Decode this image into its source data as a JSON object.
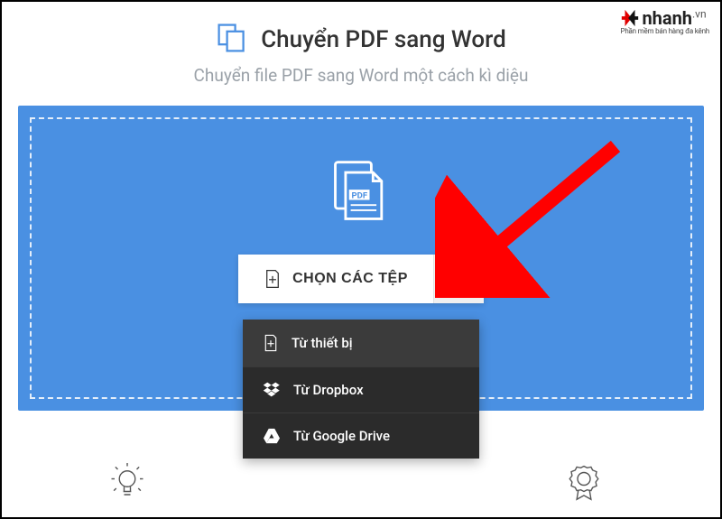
{
  "brand": {
    "name": "nhanh",
    "tld": ".vn",
    "tagline": "Phần mềm bán hàng đa kênh"
  },
  "header": {
    "title": "Chuyển PDF sang Word",
    "subtitle": "Chuyển file PDF sang Word một cách kì diệu"
  },
  "dropzone": {
    "choose_label": "CHỌN CÁC TỆP"
  },
  "menu": {
    "from_device": "Từ thiết bị",
    "from_dropbox": "Từ Dropbox",
    "from_drive": "Từ Google Drive"
  }
}
